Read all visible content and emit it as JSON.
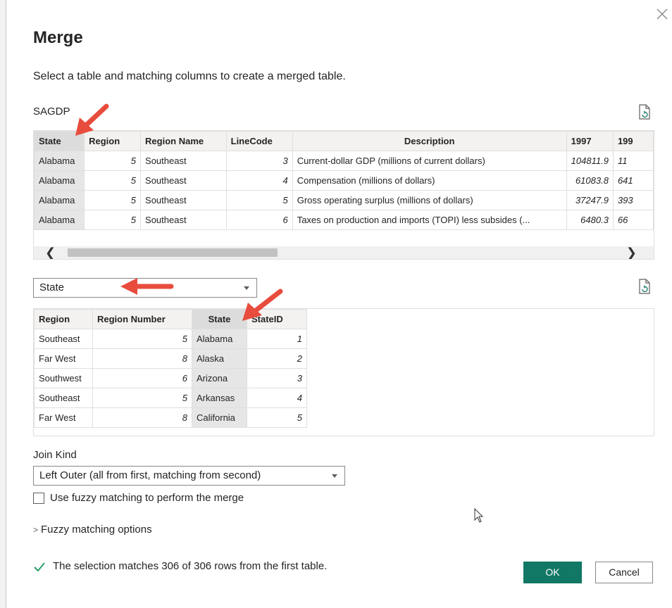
{
  "dialog": {
    "title": "Merge",
    "subtitle": "Select a table and matching columns to create a merged table."
  },
  "table1": {
    "name": "SAGDP",
    "columns": [
      "State",
      "Region",
      "Region Name",
      "LineCode",
      "Description",
      "1997",
      "199"
    ],
    "rows": [
      [
        "Alabama",
        "5",
        "Southeast",
        "3",
        "Current-dollar GDP (millions of current dollars)",
        "104811.9",
        "11"
      ],
      [
        "Alabama",
        "5",
        "Southeast",
        "4",
        "Compensation (millions of dollars)",
        "61083.8",
        "641"
      ],
      [
        "Alabama",
        "5",
        "Southeast",
        "5",
        "Gross operating surplus (millions of dollars)",
        "37247.9",
        "393"
      ],
      [
        "Alabama",
        "5",
        "Southeast",
        "6",
        "Taxes on production and imports (TOPI) less subsides (...",
        "6480.3",
        "66"
      ]
    ]
  },
  "table2": {
    "selected": "State",
    "columns": [
      "Region",
      "Region Number",
      "State",
      "StateID"
    ],
    "rows": [
      [
        "Southeast",
        "5",
        "Alabama",
        "1"
      ],
      [
        "Far West",
        "8",
        "Alaska",
        "2"
      ],
      [
        "Southwest",
        "6",
        "Arizona",
        "3"
      ],
      [
        "Southeast",
        "5",
        "Arkansas",
        "4"
      ],
      [
        "Far West",
        "8",
        "California",
        "5"
      ]
    ]
  },
  "join": {
    "label": "Join Kind",
    "value": "Left Outer (all from first, matching from second)",
    "fuzzy_label": "Use fuzzy matching to perform the merge",
    "fuzzy_checked": false,
    "fuzzy_options": "Fuzzy matching options"
  },
  "status": {
    "message": "The selection matches 306 of 306 rows from the first table."
  },
  "buttons": {
    "ok": "OK",
    "cancel": "Cancel"
  },
  "colors": {
    "accent": "#117865",
    "annotation_arrow": "#e84c3d",
    "check": "#2e9e6b"
  },
  "icons": [
    "close-icon",
    "refresh-icon",
    "chevron-down-icon",
    "checkmark-icon",
    "chevron-right-icon",
    "mouse-pointer-icon"
  ]
}
